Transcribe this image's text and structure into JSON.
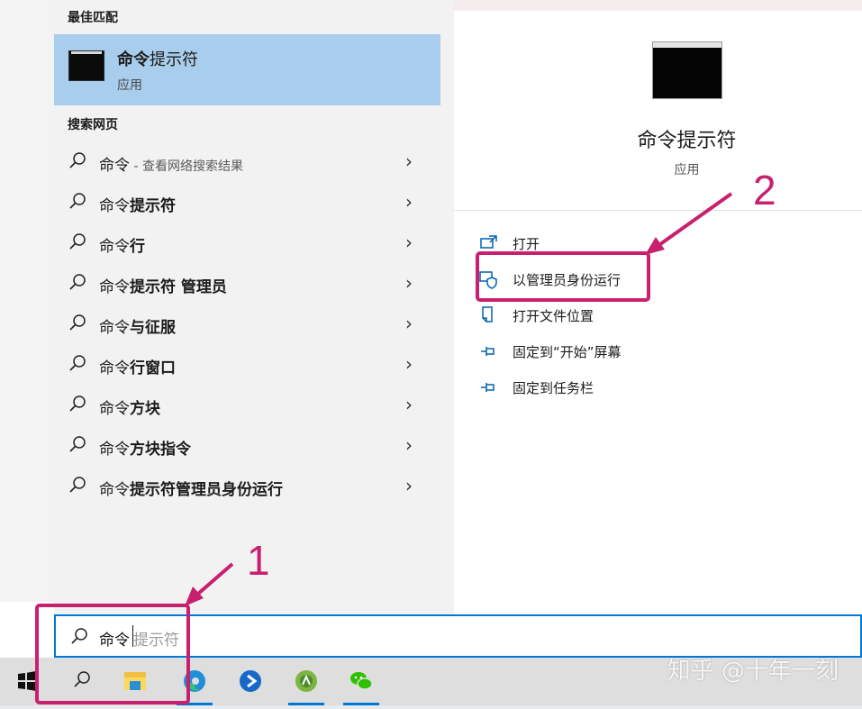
{
  "left": {
    "best_match_title": "最佳匹配",
    "best_match": {
      "name_bold": "命令",
      "name_rest": "提示符",
      "subtitle": "应用"
    },
    "web_title": "搜索网页",
    "web_items": [
      {
        "prefix": "命令",
        "suffix": " - 查看网络搜索结果",
        "suffix_style": "muted"
      },
      {
        "prefix": "命令",
        "suffix": "提示符",
        "suffix_style": "bold"
      },
      {
        "prefix": "命令",
        "suffix": "行",
        "suffix_style": "bold"
      },
      {
        "prefix": "命令",
        "suffix": "提示符 管理员",
        "suffix_style": "bold"
      },
      {
        "prefix": "命令",
        "suffix": "与征服",
        "suffix_style": "bold"
      },
      {
        "prefix": "命令",
        "suffix": "行窗口",
        "suffix_style": "bold"
      },
      {
        "prefix": "命令",
        "suffix": "方块",
        "suffix_style": "bold"
      },
      {
        "prefix": "命令",
        "suffix": "方块指令",
        "suffix_style": "bold"
      },
      {
        "prefix": "命令",
        "suffix": "提示符管理员身份运行",
        "suffix_style": "bold"
      }
    ],
    "chevron": "›"
  },
  "right": {
    "app_name": "命令提示符",
    "app_type": "应用",
    "actions": [
      {
        "label": "打开",
        "icon": "open-icon"
      },
      {
        "label": "以管理员身份运行",
        "icon": "shield-admin-icon"
      },
      {
        "label": "打开文件位置",
        "icon": "file-location-icon"
      },
      {
        "label": "固定到“开始”屏幕",
        "icon": "pin-icon"
      },
      {
        "label": "固定到任务栏",
        "icon": "pin-icon"
      }
    ]
  },
  "search": {
    "typed": "命令",
    "placeholder": "提示符"
  },
  "annotations": {
    "step1": "1",
    "step2": "2",
    "color": "#c8206f"
  },
  "watermark": "知乎 @十年一刻",
  "colors": {
    "accent": "#0078d7",
    "selection": "#a9cdec"
  },
  "taskbar": [
    "windows-start-icon",
    "search-icon",
    "file-explorer-icon",
    "edge-icon",
    "app-store-icon",
    "android-studio-icon",
    "wechat-icon"
  ]
}
